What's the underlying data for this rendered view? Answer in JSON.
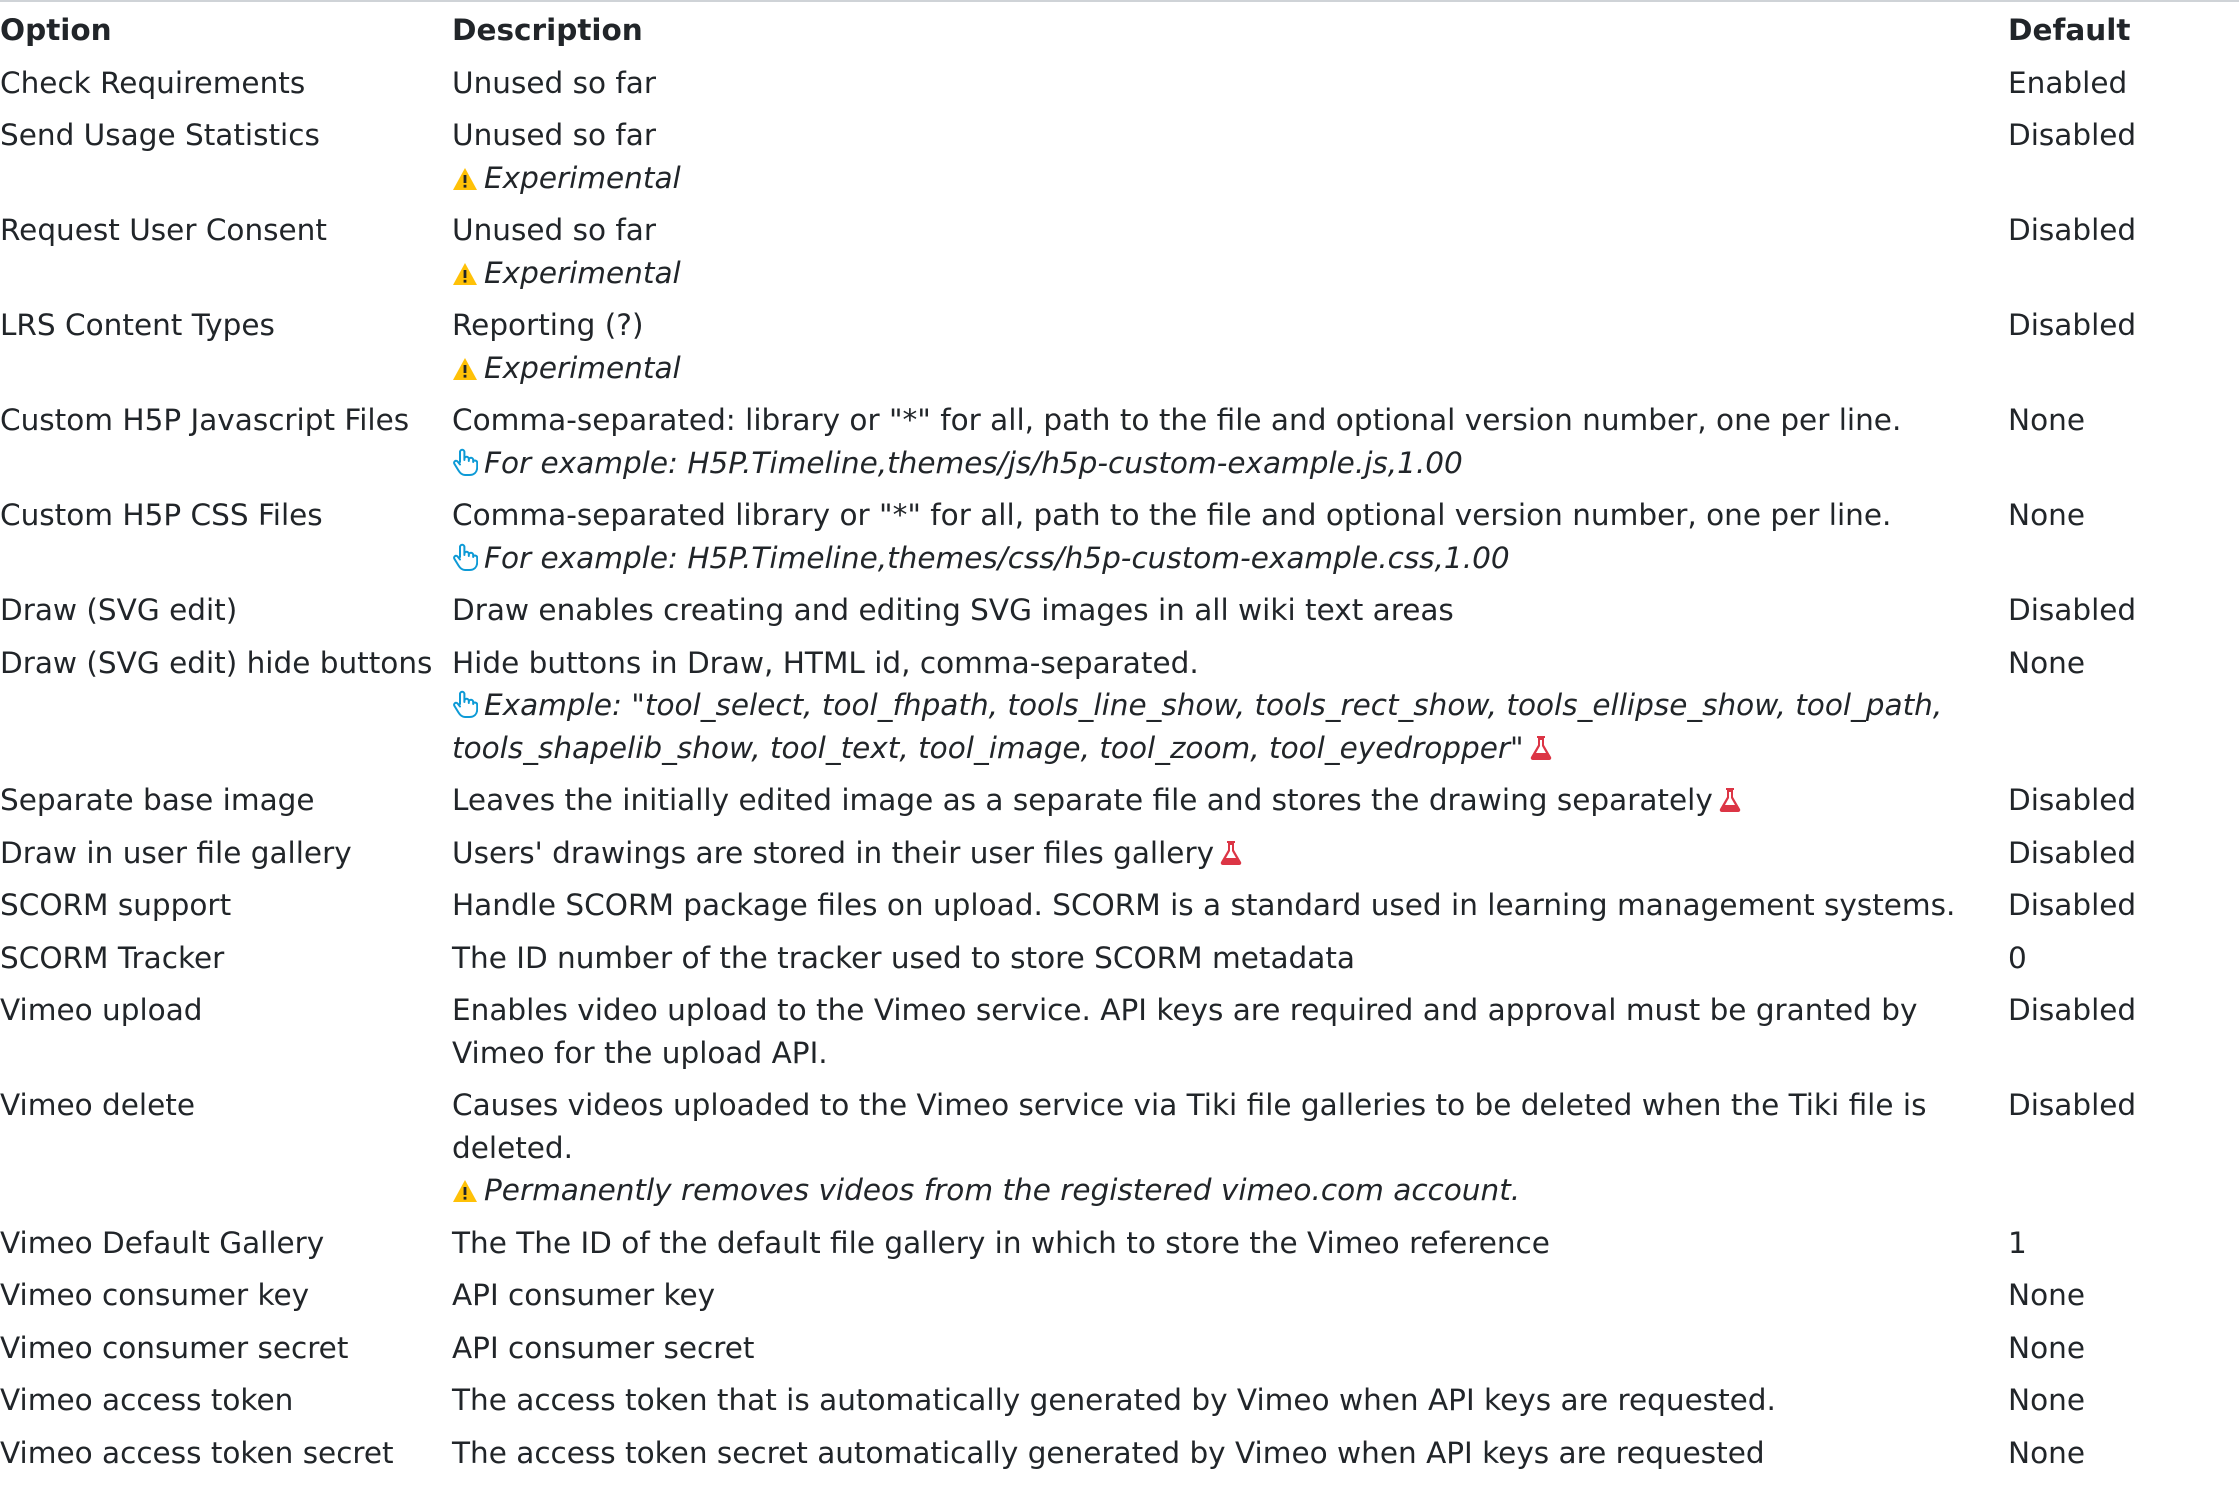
{
  "columns": {
    "option": "Option",
    "description": "Description",
    "default": "Default"
  },
  "colors": {
    "text": "#212529",
    "warning": "#ffc107",
    "tip": "#0d9ad6",
    "flask": "#dc3545"
  },
  "rows": [
    {
      "option": "Check Requirements",
      "description": "Unused so far",
      "default": "Enabled"
    },
    {
      "option": "Send Usage Statistics",
      "description": "Unused so far",
      "note": "Experimental",
      "note_icon": "warning-icon",
      "default": "Disabled"
    },
    {
      "option": "Request User Consent",
      "description": "Unused so far",
      "note": "Experimental",
      "note_icon": "warning-icon",
      "default": "Disabled"
    },
    {
      "option": "LRS Content Types",
      "description": "Reporting (?)",
      "note": "Experimental",
      "note_icon": "warning-icon",
      "default": "Disabled"
    },
    {
      "option": "Custom H5P Javascript Files",
      "description": "Comma-separated: library or \"*\" for all, path to the file and optional version number, one per line.",
      "note": "For example: H5P.Timeline,themes/js/h5p-custom-example.js,1.00",
      "note_icon": "pointing-hand-icon",
      "default": "None"
    },
    {
      "option": "Custom H5P CSS Files",
      "description": "Comma-separated library or \"*\" for all, path to the file and optional version number, one per line.",
      "note": "For example: H5P.Timeline,themes/css/h5p-custom-example.css,1.00",
      "note_icon": "pointing-hand-icon",
      "default": "None"
    },
    {
      "option": "Draw (SVG edit)",
      "description": "Draw enables creating and editing SVG images in all wiki text areas",
      "default": "Disabled"
    },
    {
      "option": "Draw (SVG edit) hide buttons",
      "description": "Hide buttons in Draw, HTML id, comma-separated.",
      "note_prefix": "Example: \"",
      "note_line1": "tool_select, tool_fhpath, tools_line_show, tools_rect_show, tools_ellipse_show, tool_path,",
      "note_line2": "tools_shapelib_show, tool_text, tool_image, tool_zoom, tool_eyedropper",
      "note_suffix": "\"",
      "note_icon": "pointing-hand-icon",
      "default": "None"
    },
    {
      "option": "Separate base image",
      "description": "Leaves the initially edited image as a separate file and stores the drawing separately",
      "default": "Disabled"
    },
    {
      "option": "Draw in user file gallery",
      "description": "Users' drawings are stored in their user files gallery",
      "default": "Disabled"
    },
    {
      "option": "SCORM support",
      "description": "Handle SCORM package files on upload. SCORM is a standard used in learning management systems.",
      "default": "Disabled"
    },
    {
      "option": "SCORM Tracker",
      "description": "The ID number of the tracker used to store SCORM metadata",
      "default": "0"
    },
    {
      "option": "Vimeo upload",
      "description_line1": "Enables video upload to the Vimeo service. API keys are required and approval must be granted by",
      "description_line2": "Vimeo for the upload API.",
      "default": "Disabled"
    },
    {
      "option": "Vimeo delete",
      "description_line1": "Causes videos uploaded to the Vimeo service via Tiki file galleries to be deleted when the Tiki file is",
      "description_line2": "deleted.",
      "note": "Permanently removes videos from the registered vimeo.com account.",
      "note_icon": "warning-icon",
      "default": "Disabled"
    },
    {
      "option": "Vimeo Default Gallery",
      "description": "The The ID of the default file gallery in which to store the Vimeo reference",
      "default": "1"
    },
    {
      "option": "Vimeo consumer key",
      "description": "API consumer key",
      "default": "None"
    },
    {
      "option": "Vimeo consumer secret",
      "description": "API consumer secret",
      "default": "None"
    },
    {
      "option": "Vimeo access token",
      "description": "The access token that is automatically generated by Vimeo when API keys are requested.",
      "default": "None"
    },
    {
      "option": "Vimeo access token secret",
      "description": "The access token secret automatically generated by Vimeo when API keys are requested",
      "default": "None"
    }
  ]
}
